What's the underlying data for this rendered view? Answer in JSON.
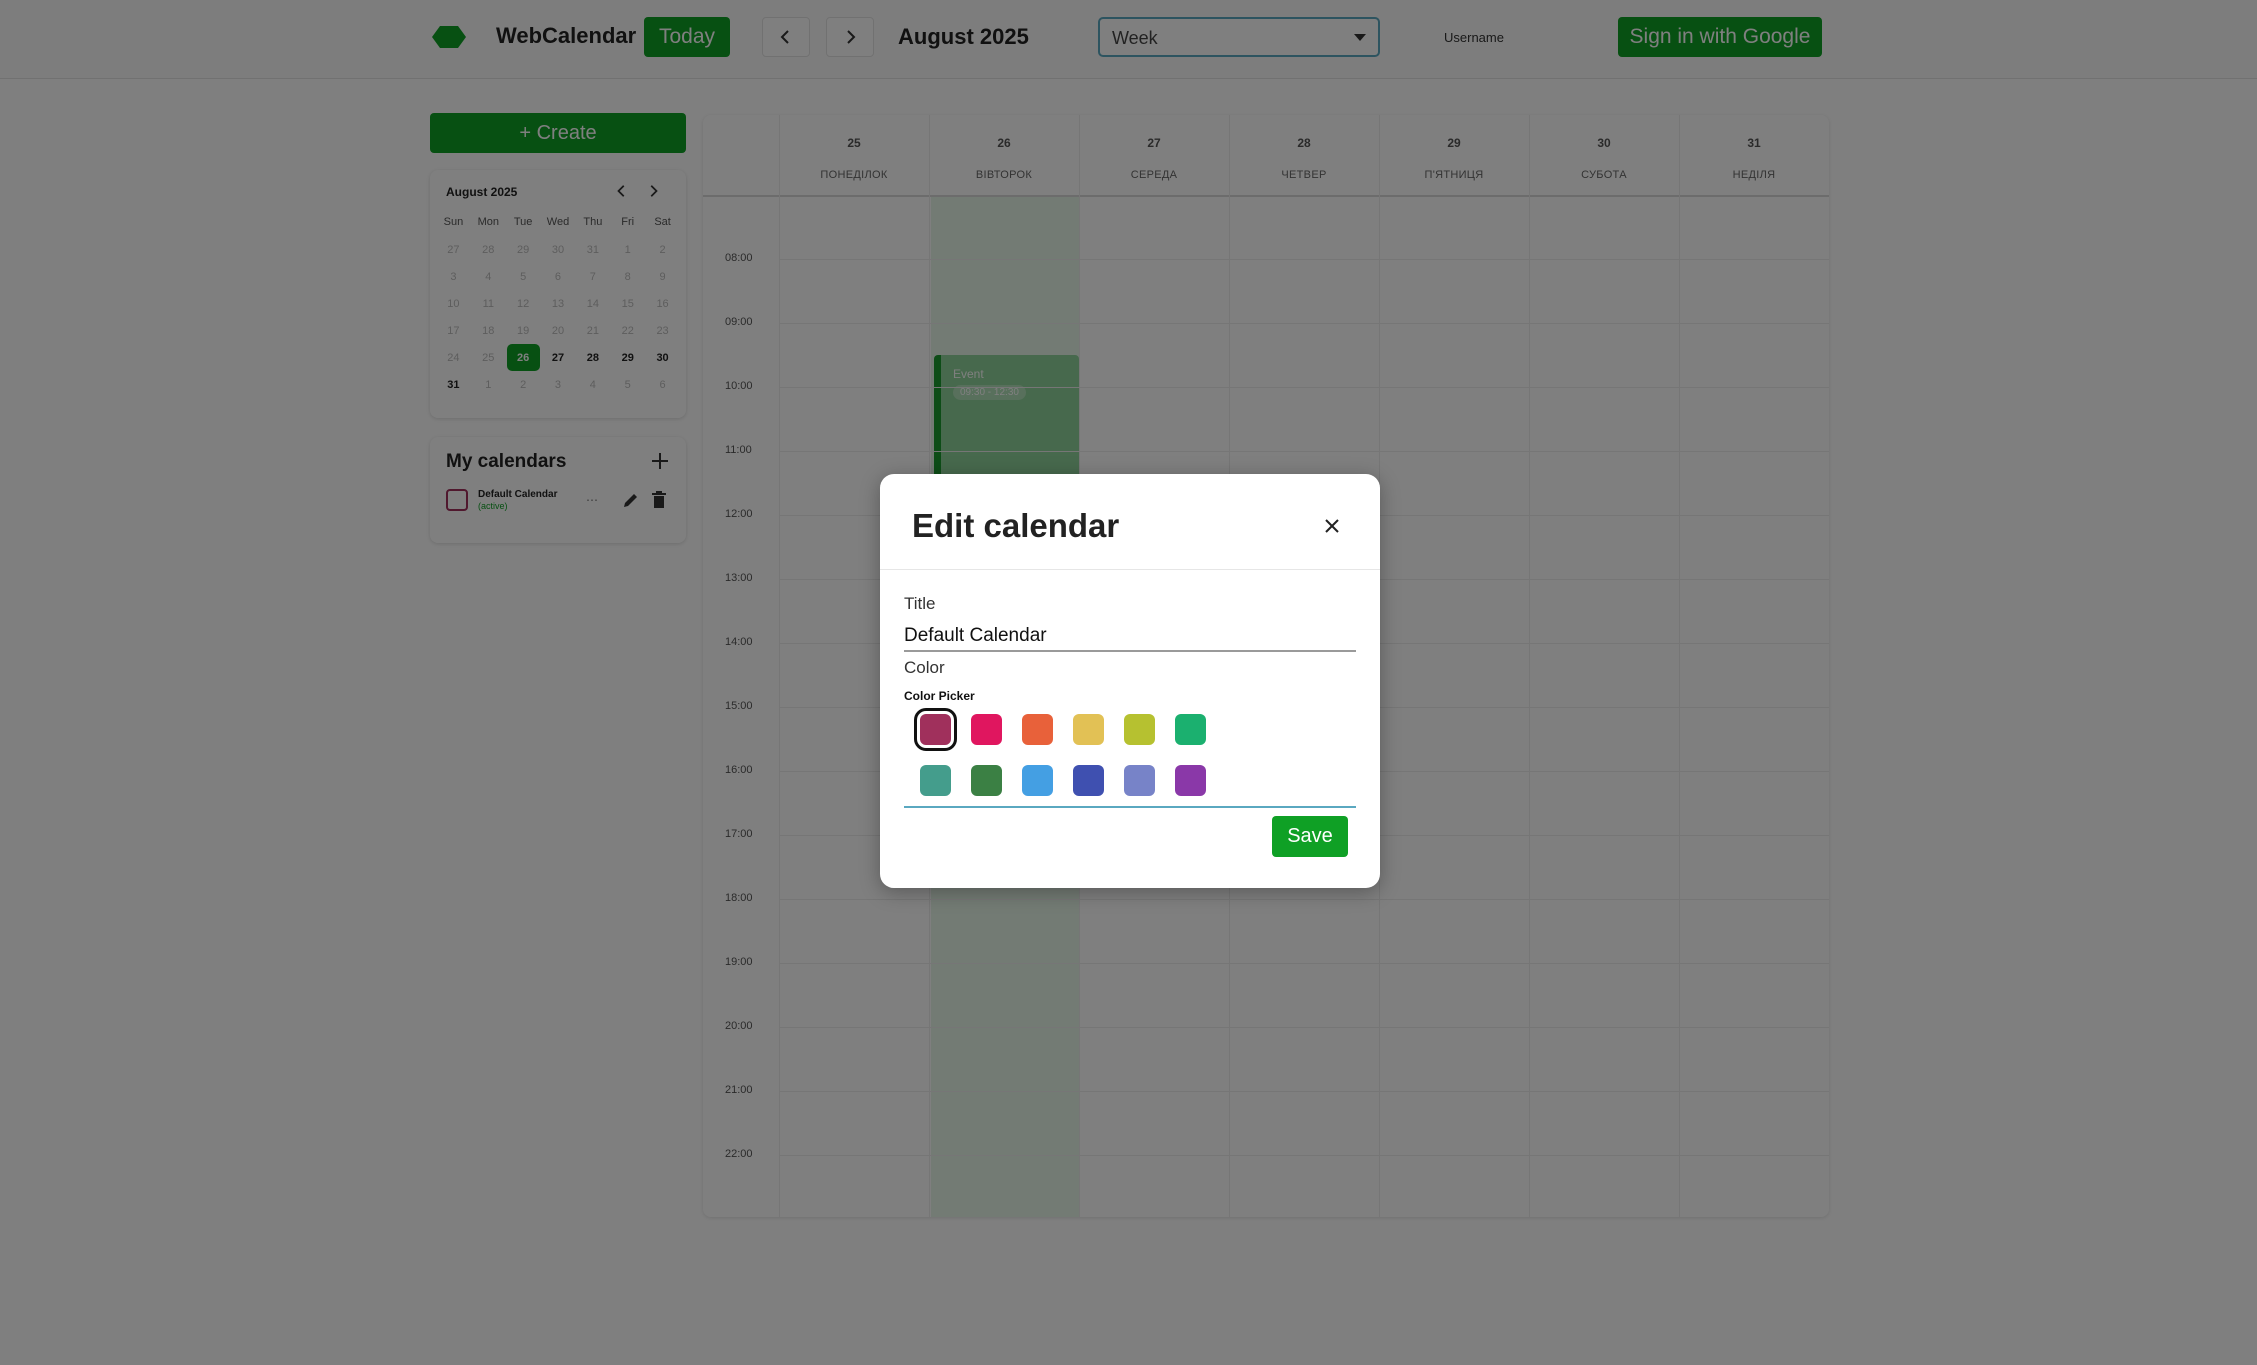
{
  "header": {
    "app_title": "WebCalendar",
    "today_label": "Today",
    "period_label": "August 2025",
    "view_select": "Week",
    "username": "Username",
    "signin_label": "Sign in with Google",
    "brand_color": "#0fa025"
  },
  "sidebar": {
    "create_label": "+ Create",
    "mini_calendar": {
      "title": "August 2025",
      "weekdays": [
        "Sun",
        "Mon",
        "Tue",
        "Wed",
        "Thu",
        "Fri",
        "Sat"
      ],
      "weeks": [
        [
          "27",
          "28",
          "29",
          "30",
          "31",
          "1",
          "2"
        ],
        [
          "3",
          "4",
          "5",
          "6",
          "7",
          "8",
          "9"
        ],
        [
          "10",
          "11",
          "12",
          "13",
          "14",
          "15",
          "16"
        ],
        [
          "17",
          "18",
          "19",
          "20",
          "21",
          "22",
          "23"
        ],
        [
          "24",
          "25",
          "26",
          "27",
          "28",
          "29",
          "30"
        ],
        [
          "31",
          "1",
          "2",
          "3",
          "4",
          "5",
          "6"
        ]
      ],
      "selected": "26"
    },
    "my_calendars": {
      "title": "My calendars",
      "items": [
        {
          "name": "Default Calendar",
          "subtitle": "(active)",
          "color": "#a0305c"
        }
      ]
    }
  },
  "week": {
    "days": [
      {
        "num": "25",
        "name": "ПОНЕДІЛОК"
      },
      {
        "num": "26",
        "name": "ВІВТОРОК"
      },
      {
        "num": "27",
        "name": "СЕРЕДА"
      },
      {
        "num": "28",
        "name": "ЧЕТВЕР"
      },
      {
        "num": "29",
        "name": "П'ЯТНИЦЯ"
      },
      {
        "num": "30",
        "name": "СУБОТА"
      },
      {
        "num": "31",
        "name": "НЕДІЛЯ"
      }
    ],
    "hours": [
      "08:00",
      "09:00",
      "10:00",
      "11:00",
      "12:00",
      "13:00",
      "14:00",
      "15:00",
      "16:00",
      "17:00",
      "18:00",
      "19:00",
      "20:00",
      "21:00",
      "22:00"
    ],
    "event": {
      "title": "Event",
      "time": "09:30 - 12:30"
    }
  },
  "modal": {
    "title": "Edit calendar",
    "title_label": "Title",
    "title_value": "Default Calendar",
    "color_label": "Color",
    "picker_label": "Color Picker",
    "colors": [
      "#a0305c",
      "#e0165f",
      "#e8613a",
      "#e2c155",
      "#b6c130",
      "#1bb06f",
      "#449d8c",
      "#3b8044",
      "#449fe3",
      "#3f50b0",
      "#7783c8",
      "#8a38a8"
    ],
    "selected_color": "#a0305c",
    "save_label": "Save"
  }
}
